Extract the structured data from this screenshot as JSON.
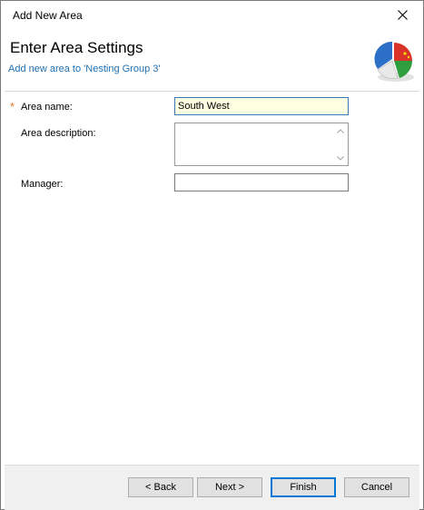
{
  "window": {
    "title": "Add New Area"
  },
  "header": {
    "title": "Enter Area Settings",
    "subtitle": "Add new area to 'Nesting Group 3'"
  },
  "form": {
    "area_name_label": "Area name:",
    "area_name_value": "South West",
    "area_description_label": "Area description:",
    "area_description_value": "",
    "manager_label": "Manager:",
    "manager_value": "",
    "required_marker": "*"
  },
  "buttons": {
    "back": "< Back",
    "next": "Next >",
    "finish": "Finish",
    "cancel": "Cancel"
  },
  "icons": [
    "close-icon",
    "pie-chart-logo-icon",
    "scroll-up-icon",
    "scroll-down-icon"
  ],
  "colors": {
    "subtitle": "#1f6fb0",
    "required": "#e8742f",
    "active_field": "#ffffe1",
    "default_button_border": "#0078d7"
  }
}
